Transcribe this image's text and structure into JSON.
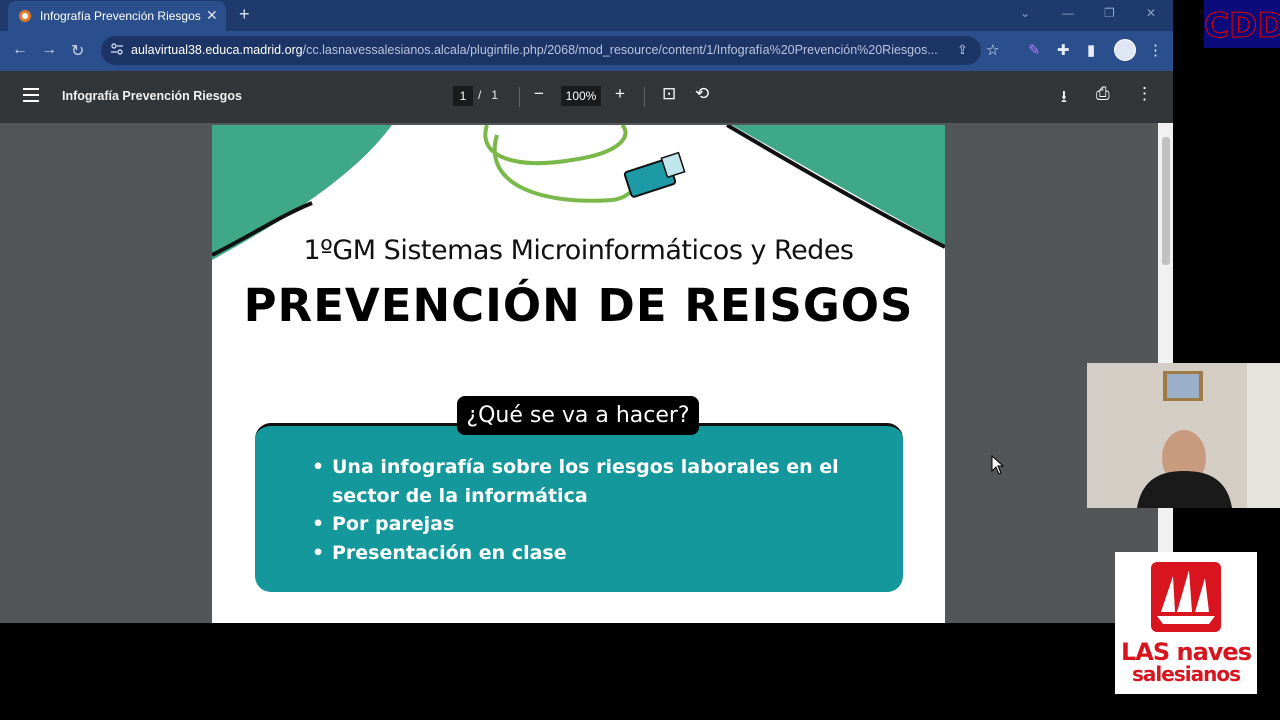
{
  "browser": {
    "tab_title": "Infografía Prevención Riesgos",
    "url_host": "aulavirtual38.educa.madrid.org",
    "url_path": "/cc.lasnavessalesianos.alcala/pluginfile.php/2068/mod_resource/content/1/Infografía%20Prevención%20Riesgos..."
  },
  "pdf_toolbar": {
    "title": "Infografía Prevención Riesgos",
    "page_current": "1",
    "page_separator": "/",
    "page_total": "1",
    "zoom": "100%"
  },
  "document": {
    "subtitle": "1ºGM Sistemas Microinformáticos y Redes",
    "title": "PREVENCIÓN DE REISGOS",
    "box_label": "¿Qué se va a hacer?",
    "bullets": [
      "Una infografía sobre los riesgos laborales en el sector de la informática",
      "Por parejas",
      "Presentación en clase"
    ]
  },
  "overlay": {
    "cdd_label": "CDD",
    "logo_line1": "LAS naves",
    "logo_line2": "salesianos"
  },
  "colors": {
    "accent_teal": "#15989b",
    "tab_strip": "#1f3b6e",
    "pdf_toolbar": "#323639",
    "brand_red": "#d8141f"
  }
}
